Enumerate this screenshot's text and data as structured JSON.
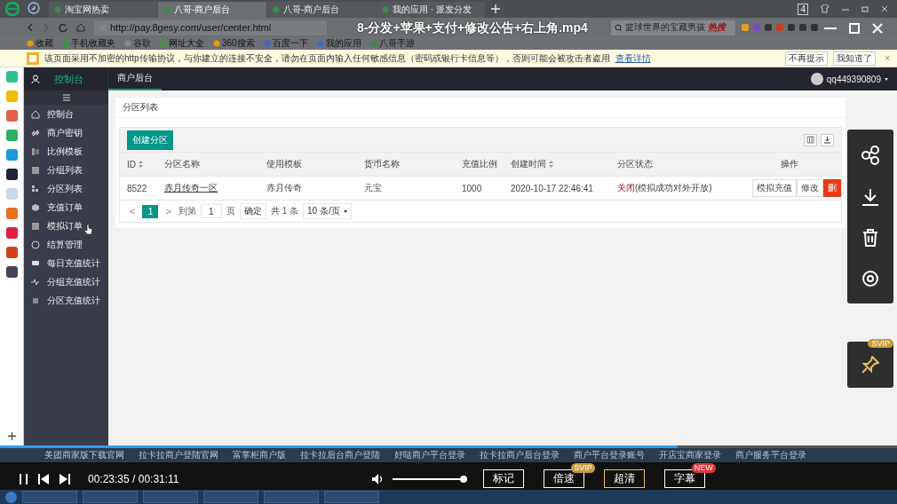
{
  "player": {
    "title": "8-分发+苹果+支付+修改公告+右上角.mp4",
    "progress": {
      "level": 0.755
    },
    "time": "00:23:35 / 00:31:11",
    "volume": {
      "level": 1
    },
    "buttons": [
      {
        "label": "标记",
        "selected": false
      },
      {
        "label": "倍速",
        "selected": false,
        "badge": {
          "text": "SVIP",
          "kind": "vip"
        }
      },
      {
        "label": "超清",
        "selected": true
      },
      {
        "label": "字幕",
        "selected": false,
        "badge": {
          "text": "NEW",
          "kind": "new"
        }
      }
    ],
    "pin_badge": "SVIP"
  },
  "browser": {
    "tabs": [
      {
        "label": "淘宝网热卖",
        "selected": false
      },
      {
        "label": "八哥-商户后台",
        "selected": true
      },
      {
        "label": "八哥-商户后台",
        "selected": false
      },
      {
        "label": "我的应用 · 派发分发",
        "selected": false
      }
    ],
    "tab_count": "4",
    "url": "http://pay.8gesy.com/user/center.html",
    "search": {
      "placeholder": "篮球世界的宝藏男孩",
      "hot": "热搜"
    },
    "bookmarks": [
      "收藏",
      "手机收藏夹",
      "谷歌",
      "网址大全",
      "360搜索",
      "百度一下",
      "我的应用",
      "八哥手游"
    ],
    "notice": {
      "text": "该页面采用不加密的http传输协议，与你建立的连接不安全，请勿在页面内输入任何敏感信息（密码或银行卡信息等），否则可能会被攻击者盗用",
      "link": "查看详情",
      "buttons": [
        "不再提示",
        "我知道了"
      ],
      "close": "×"
    },
    "bottom_links": [
      "美团商家版下载官网",
      "拉卡拉商户登陆官网",
      "富掌柜商户版",
      "拉卡拉后台商户登陆",
      "好哒商户平台登录",
      "拉卡拉商户后台登录",
      "商户平台登录账号",
      "开店宝商家登录",
      "商户服务平台登录"
    ]
  },
  "app": {
    "brand": "控制台",
    "nav_tabs": [
      {
        "label": "商户后台",
        "selected": true
      }
    ],
    "user": "qq449390809",
    "menu": [
      "控制台",
      "商户密钥",
      "比例模板",
      "分组列表",
      "分区列表",
      "充值订单",
      "模拟订单",
      "结算管理",
      "每日充值统计",
      "分组充值统计",
      "分区充值统计"
    ],
    "page_title": "分区列表",
    "create_button": "创建分区",
    "columns": [
      {
        "label": "ID",
        "sortable": true
      },
      {
        "label": "分区名称",
        "sortable": false
      },
      {
        "label": "使用模板",
        "sortable": false
      },
      {
        "label": "货币名称",
        "sortable": false
      },
      {
        "label": "充值比例",
        "sortable": false
      },
      {
        "label": "创建时间",
        "sortable": true
      },
      {
        "label": "分区状态",
        "sortable": false
      },
      {
        "label": "操作",
        "sortable": false
      }
    ],
    "rows": [
      {
        "id": "8522",
        "name": "赤月传奇一区",
        "template": "赤月传奇",
        "currency": "元宝",
        "ratio": "1000",
        "created": "2020-10-17 22:46:41",
        "status": "关闭",
        "status_note": "(模拟成功对外开放)",
        "actions": [
          {
            "label": "模拟充值",
            "kind": "default"
          },
          {
            "label": "修改",
            "kind": "default"
          },
          {
            "label": "删",
            "kind": "danger"
          }
        ]
      }
    ],
    "pagination": {
      "prev": "<",
      "pages": [
        {
          "label": "1",
          "selected": true
        }
      ],
      "next": ">",
      "goto": "到第",
      "page_input": "1",
      "page_unit": "页",
      "confirm": "确定",
      "total": "共 1 条",
      "page_size": "10 条/页"
    }
  }
}
